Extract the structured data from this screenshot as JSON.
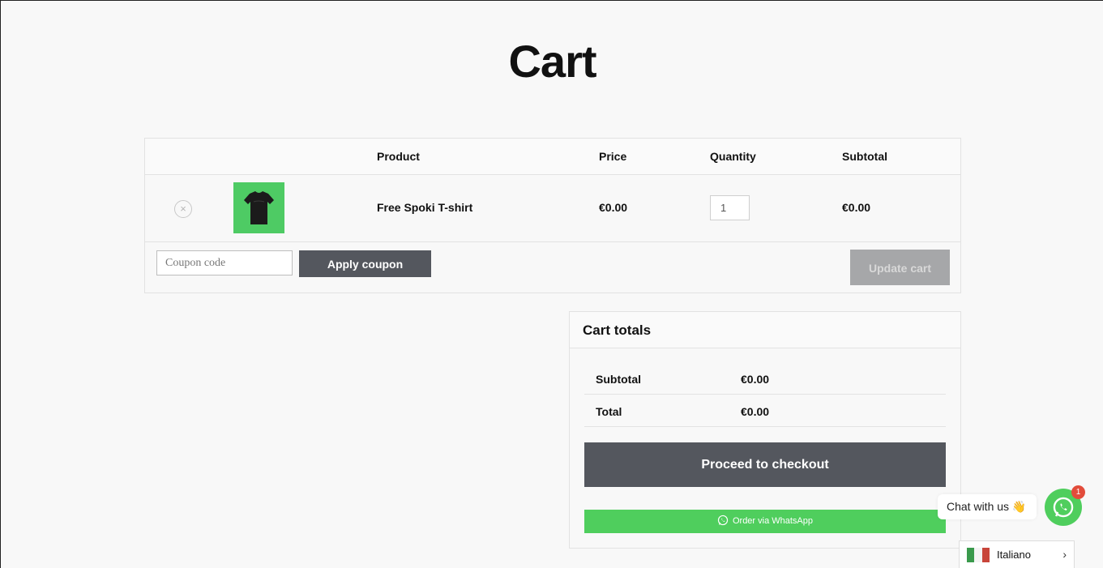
{
  "page": {
    "title": "Cart"
  },
  "cart": {
    "headers": {
      "product": "Product",
      "price": "Price",
      "quantity": "Quantity",
      "subtotal": "Subtotal"
    },
    "items": [
      {
        "name": "Free Spoki T-shirt",
        "price": "€0.00",
        "quantity": "1",
        "subtotal": "€0.00",
        "remove_symbol": "×",
        "image_icon": "tshirt-product-image"
      }
    ],
    "coupon": {
      "placeholder": "Coupon code",
      "value": "",
      "apply_label": "Apply coupon"
    },
    "update_label": "Update cart"
  },
  "totals": {
    "title": "Cart totals",
    "subtotal_label": "Subtotal",
    "subtotal_value": "€0.00",
    "total_label": "Total",
    "total_value": "€0.00",
    "checkout_label": "Proceed to checkout",
    "whatsapp_label": "Order via WhatsApp"
  },
  "chat": {
    "bubble_text": "Chat with us 👋",
    "badge_count": "1"
  },
  "language": {
    "selected": "Italiano",
    "chevron": "›"
  },
  "colors": {
    "accent_button": "#54575e",
    "whatsapp_green": "#4fce5d",
    "disabled_button": "#a6a7a9",
    "badge_red": "#e24c3b"
  }
}
